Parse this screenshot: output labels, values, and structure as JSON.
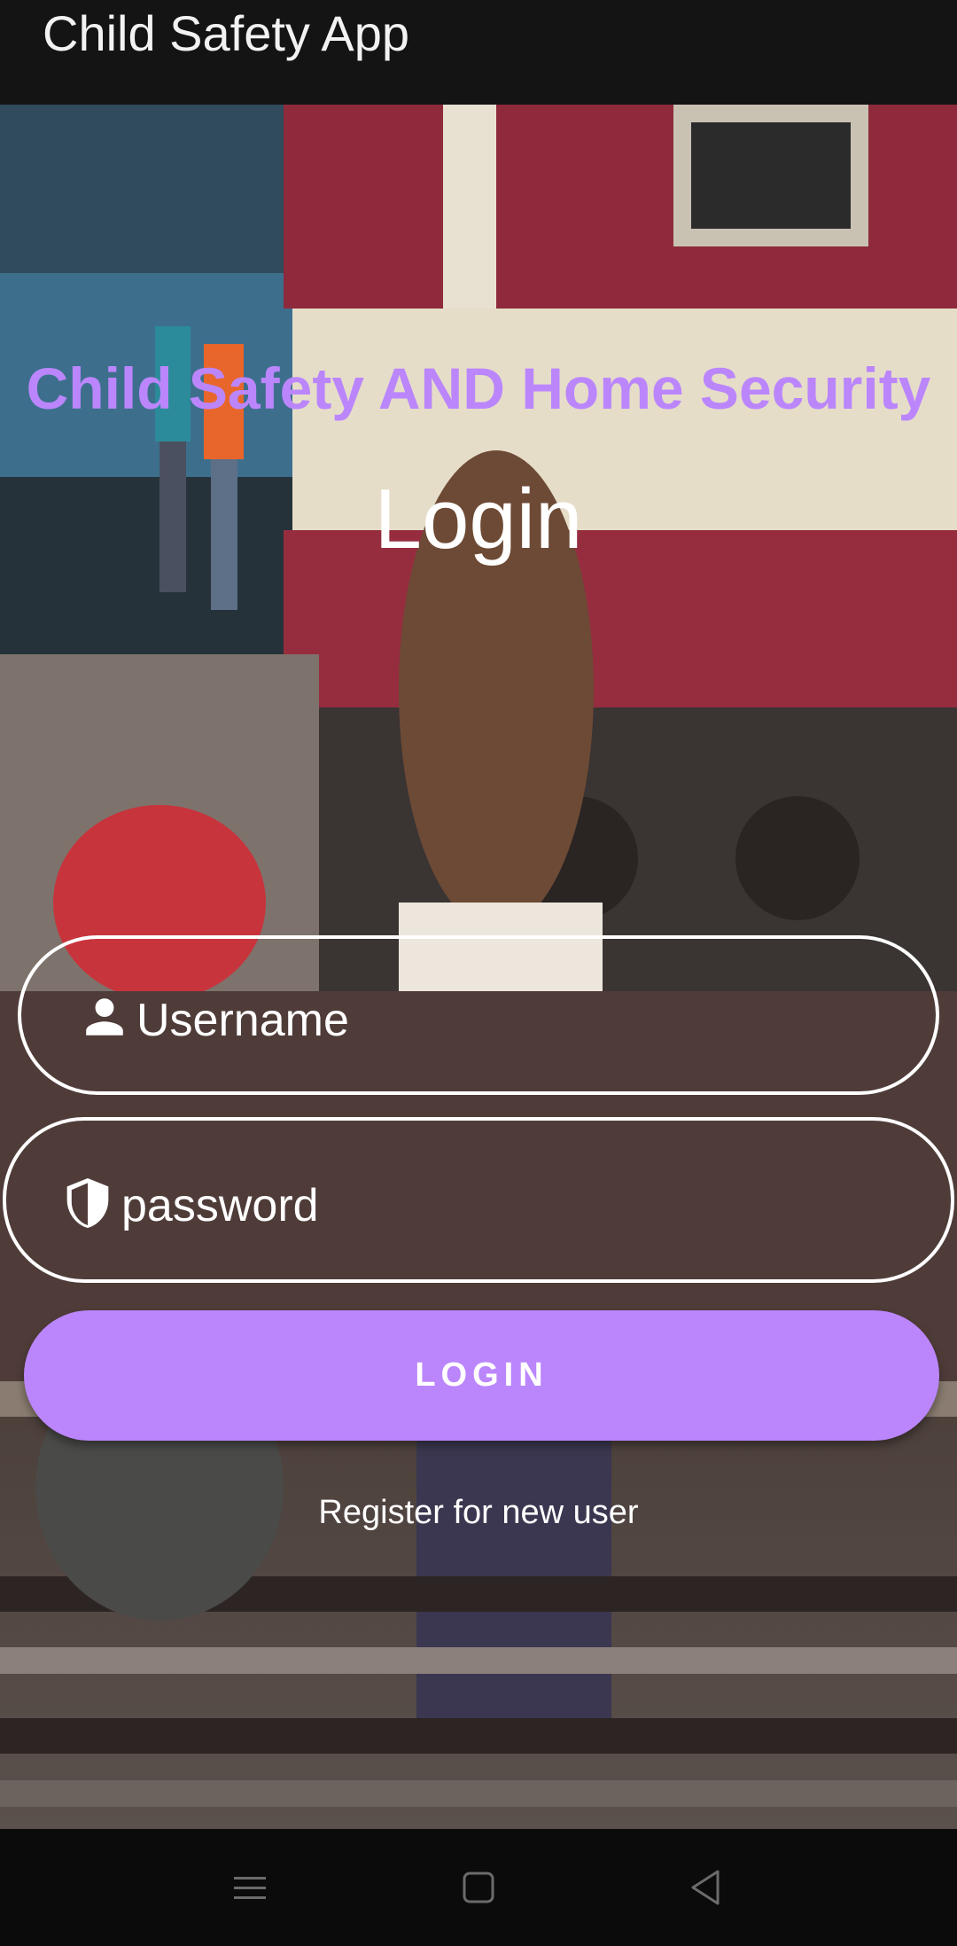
{
  "app_bar": {
    "title": "Child Safety App"
  },
  "main": {
    "headline": "Child Safety AND Home Security",
    "login_title": "Login",
    "username_field": {
      "placeholder": "Username",
      "icon": "person-icon"
    },
    "password_field": {
      "placeholder": "password",
      "icon": "shield-icon"
    },
    "login_button": "LOGIN",
    "register_link": "Register for new user"
  },
  "background": {
    "description_icon": "background-photo"
  },
  "nav_bar": {
    "buttons": [
      "menu-icon",
      "home-icon",
      "back-icon"
    ]
  },
  "colors": {
    "accent": "#bb86fc",
    "app_bar": "#141414",
    "nav_bar": "#0b0b0b"
  }
}
